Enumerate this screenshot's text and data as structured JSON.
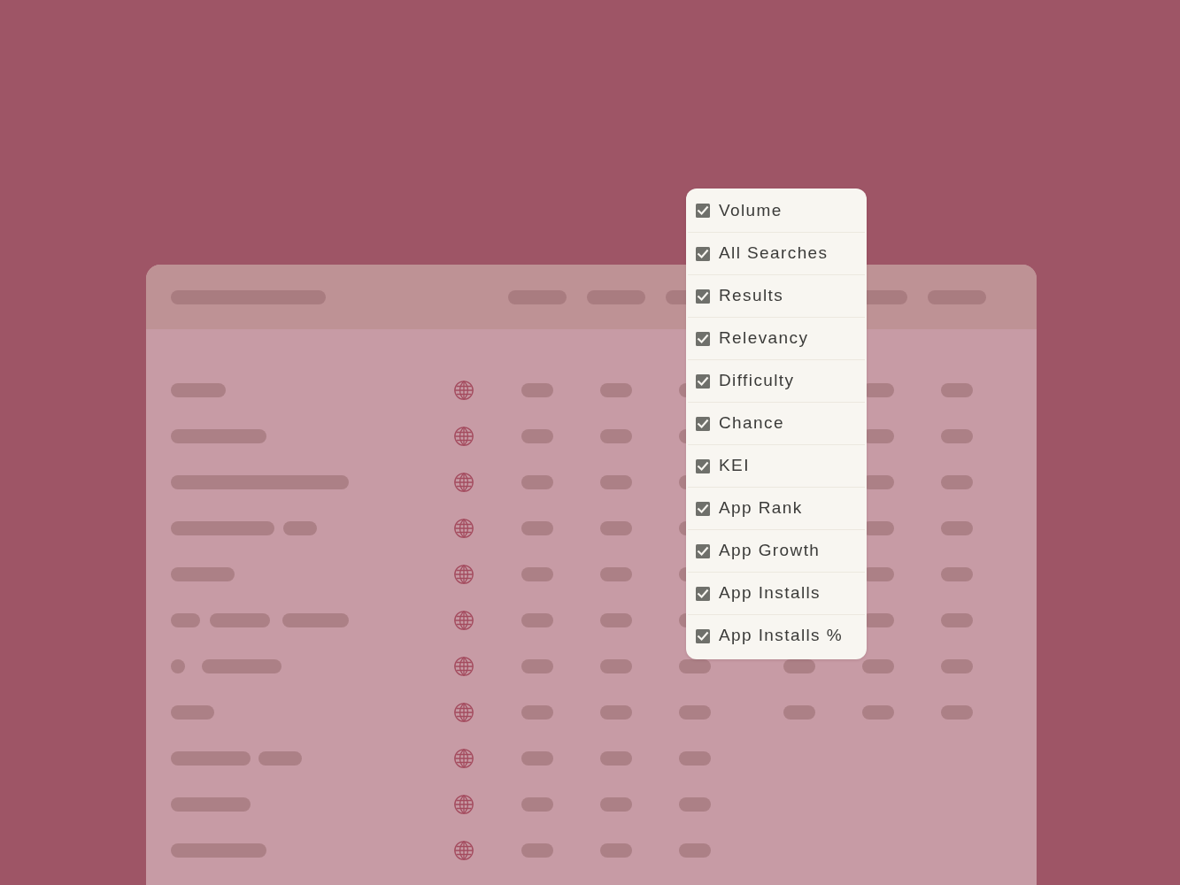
{
  "column_menu": {
    "items": [
      {
        "label": "Volume",
        "checked": true
      },
      {
        "label": "All Searches",
        "checked": true
      },
      {
        "label": "Results",
        "checked": true
      },
      {
        "label": "Relevancy",
        "checked": true
      },
      {
        "label": "Difficulty",
        "checked": true
      },
      {
        "label": "Chance",
        "checked": true
      },
      {
        "label": "KEI",
        "checked": true
      },
      {
        "label": "App Rank",
        "checked": true
      },
      {
        "label": "App Growth",
        "checked": true
      },
      {
        "label": "App Installs",
        "checked": true
      },
      {
        "label": "App Installs %",
        "checked": true
      }
    ]
  }
}
